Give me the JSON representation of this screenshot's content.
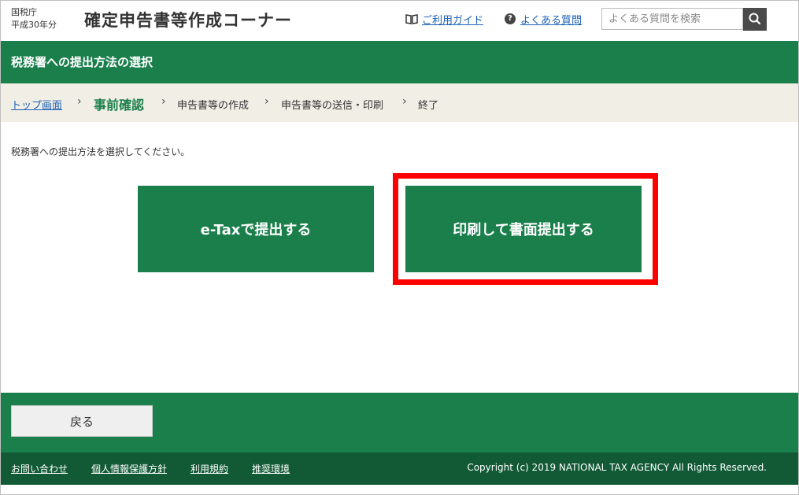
{
  "header": {
    "agency_name": "国税庁",
    "tax_year": "平成30年分",
    "site_title": "確定申告書等作成コーナー",
    "guide_label": "ご利用ガイド",
    "faq_label": "よくある質問",
    "search_placeholder": "よくある質問を検索"
  },
  "page_title": "税務署への提出方法の選択",
  "breadcrumb": {
    "items": [
      "トップ画面",
      "事前確認",
      "申告書等の作成",
      "申告書等の送信・印刷",
      "終了"
    ],
    "separator": "›"
  },
  "main": {
    "instruction": "税務署への提出方法を選択してください。",
    "etax_label": "e-Taxで提出する",
    "print_label": "印刷して書面提出する"
  },
  "footer": {
    "back_label": "戻る",
    "links": [
      "お問い合わせ",
      "個人情報保護方針",
      "利用規約",
      "推奨環境"
    ],
    "copyright": "Copyright (c) 2019 NATIONAL TAX AGENCY All Rights Reserved."
  },
  "colors": {
    "brand_green": "#1a7f4b",
    "footer_dark_green": "#115a35",
    "breadcrumb_bg": "#f1eee6",
    "highlight_red": "#ff0000",
    "link_blue": "#1a5fb4"
  },
  "icons": {
    "guide": "book-icon",
    "faq": "question-circle-icon",
    "search": "search-icon",
    "breadcrumb_separator": "chevron-right-icon"
  }
}
